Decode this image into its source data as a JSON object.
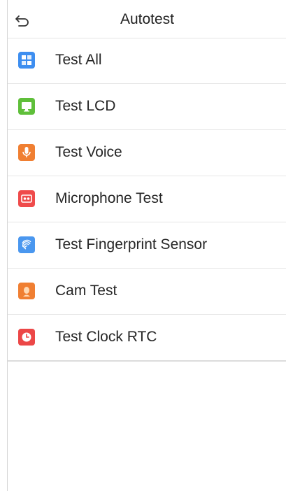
{
  "header": {
    "back_icon": "back-arrow-icon",
    "title": "Autotest"
  },
  "menu": {
    "items": [
      {
        "label": "Test All",
        "icon": "grid-icon",
        "color": "#3d8ef0"
      },
      {
        "label": "Test LCD",
        "icon": "monitor-icon",
        "color": "#5fbf3a"
      },
      {
        "label": "Test Voice",
        "icon": "microphone-icon",
        "color": "#f07f32"
      },
      {
        "label": "Microphone Test",
        "icon": "cassette-icon",
        "color": "#ef4b4b"
      },
      {
        "label": "Test Fingerprint Sensor",
        "icon": "fingerprint-icon",
        "color": "#4a97ef"
      },
      {
        "label": "Cam Test",
        "icon": "face-icon",
        "color": "#f07f32"
      },
      {
        "label": "Test Clock RTC",
        "icon": "clock-icon",
        "color": "#ec4747"
      }
    ]
  }
}
